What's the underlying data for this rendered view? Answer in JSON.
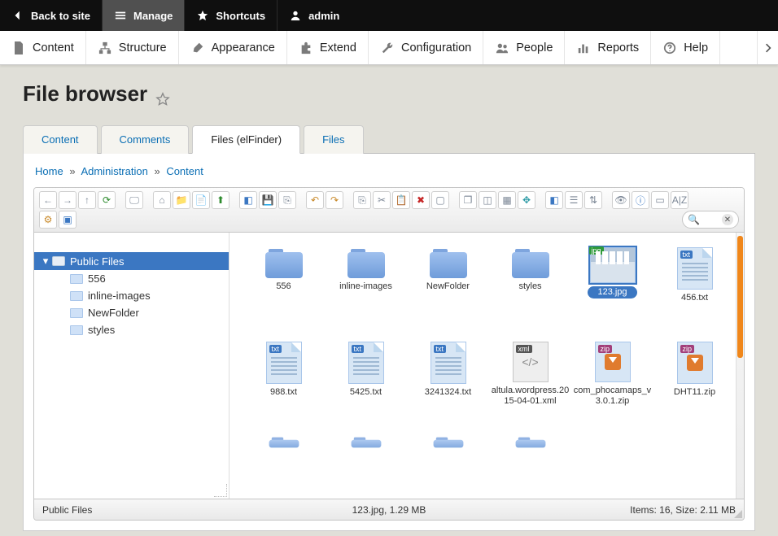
{
  "toolbar": {
    "back": "Back to site",
    "manage": "Manage",
    "shortcuts": "Shortcuts",
    "user": "admin"
  },
  "admin_menu": {
    "content": "Content",
    "structure": "Structure",
    "appearance": "Appearance",
    "extend": "Extend",
    "configuration": "Configuration",
    "people": "People",
    "reports": "Reports",
    "help": "Help"
  },
  "page": {
    "title": "File browser"
  },
  "tabs": {
    "content": "Content",
    "comments": "Comments",
    "files_elfinder": "Files (elFinder)",
    "files": "Files"
  },
  "breadcrumb": {
    "home": "Home",
    "admin": "Administration",
    "content": "Content"
  },
  "tree": {
    "root": "Public Files",
    "children": [
      "556",
      "inline-images",
      "NewFolder",
      "styles"
    ]
  },
  "files_row1": [
    {
      "type": "folder",
      "name": "556"
    },
    {
      "type": "folder",
      "name": "inline-images"
    },
    {
      "type": "folder",
      "name": "NewFolder"
    },
    {
      "type": "folder",
      "name": "styles"
    },
    {
      "type": "jpg",
      "name": "123.jpg",
      "selected": true
    },
    {
      "type": "txt",
      "name": "456.txt"
    }
  ],
  "files_row2": [
    {
      "type": "txt",
      "name": "988.txt"
    },
    {
      "type": "txt",
      "name": "5425.txt"
    },
    {
      "type": "txt",
      "name": "3241324.txt"
    },
    {
      "type": "xml",
      "name": "altula.wordpress.2015-04-01.xml"
    },
    {
      "type": "zip",
      "name": "com_phocamaps_v3.0.1.zip"
    },
    {
      "type": "zip",
      "name": "DHT11.zip"
    }
  ],
  "status": {
    "path": "Public Files",
    "selection": "123.jpg, 1.29 MB",
    "summary": "Items: 16, Size: 2.11 MB"
  }
}
